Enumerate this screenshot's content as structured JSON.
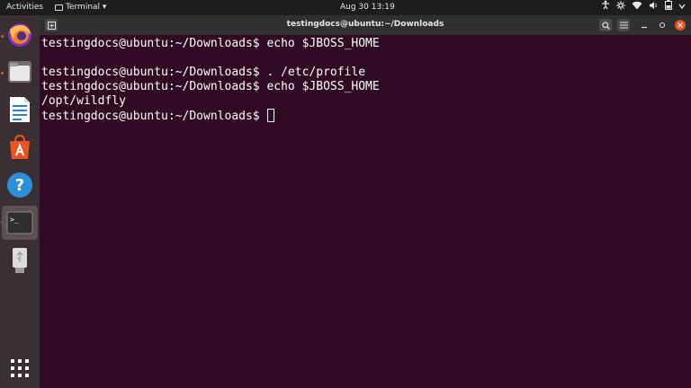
{
  "topbar": {
    "activities": "Activities",
    "app_menu": "Terminal ▾",
    "clock": "Aug 30  13:19"
  },
  "window": {
    "title": "testingdocs@ubuntu:~/Downloads"
  },
  "terminal": {
    "lines": [
      "testingdocs@ubuntu:~/Downloads$ echo $JBOSS_HOME",
      "",
      "testingdocs@ubuntu:~/Downloads$ . /etc/profile",
      "testingdocs@ubuntu:~/Downloads$ echo $JBOSS_HOME",
      "/opt/wildfly",
      "testingdocs@ubuntu:~/Downloads$ "
    ]
  },
  "dock": {
    "items": [
      "firefox-icon",
      "files-icon",
      "writer-icon",
      "software-icon",
      "help-icon",
      "terminal-icon",
      "usb-drive-icon",
      "app-grid-icon"
    ]
  },
  "colors": {
    "terminal_bg": "#300a24",
    "accent": "#e95420",
    "dock_bg": "#3a2f33"
  }
}
